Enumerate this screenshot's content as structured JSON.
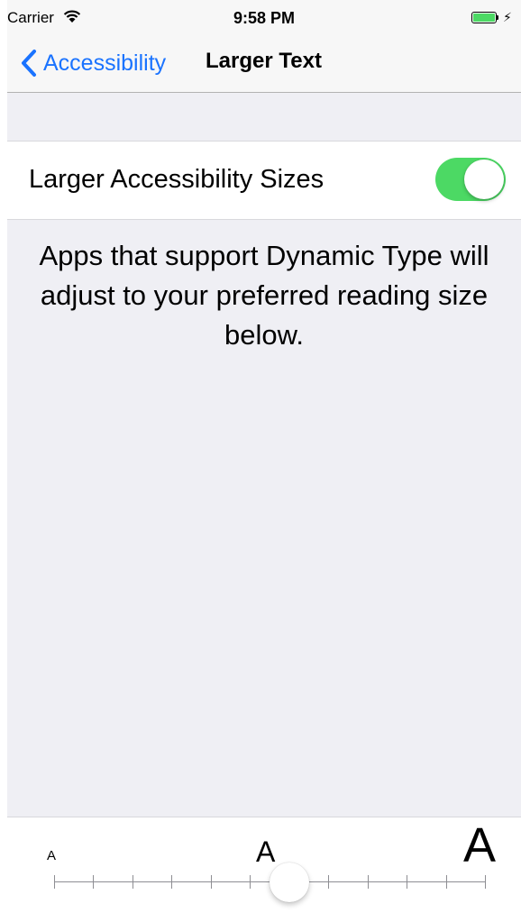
{
  "status_bar": {
    "carrier": "Carrier",
    "time": "9:58 PM",
    "wifi_icon": "wifi-icon",
    "battery_icon": "battery-icon",
    "charging_icon": "charging-bolt-icon",
    "battery_level": 1.0
  },
  "nav": {
    "back_label": "Accessibility",
    "back_icon": "chevron-left-icon",
    "title": "Larger Text"
  },
  "toggle": {
    "label": "Larger Accessibility Sizes",
    "on": true
  },
  "description": "Apps that support Dynamic Type will adjust to your preferred reading size below.",
  "slider": {
    "small_label": "A",
    "medium_label": "A",
    "large_label": "A",
    "steps": 12,
    "selected_step": 6
  },
  "colors": {
    "accent": "#1a73ff",
    "switch_on": "#4cd964",
    "background": "#efeff4"
  }
}
